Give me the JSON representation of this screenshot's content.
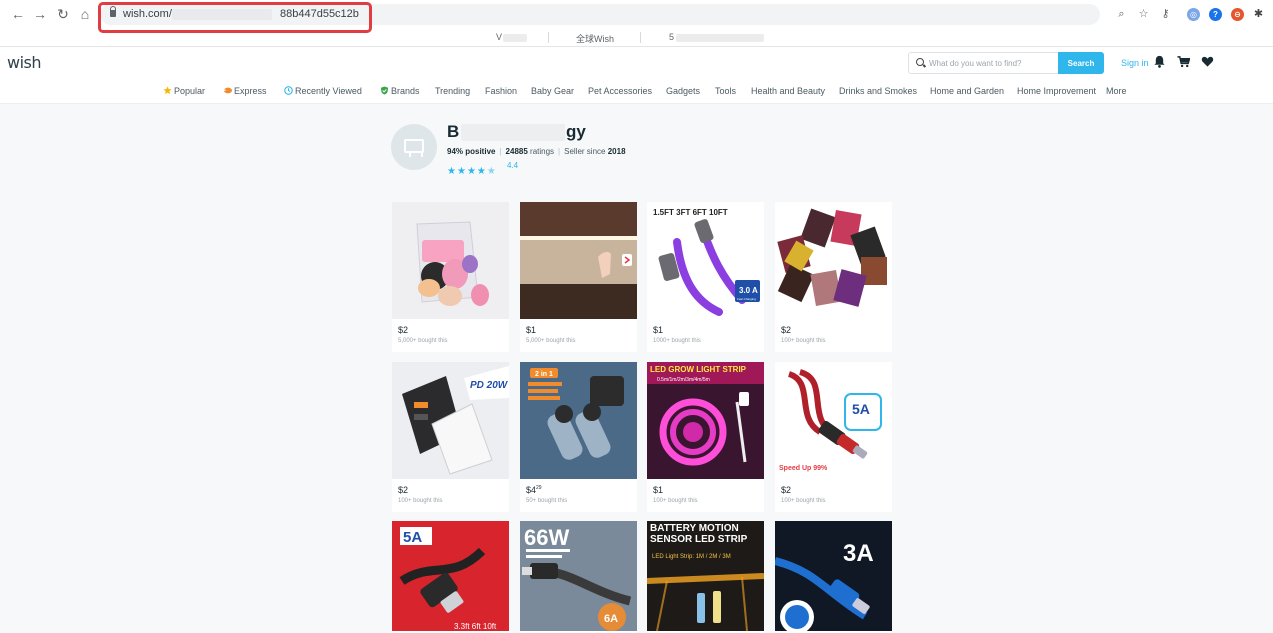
{
  "browser": {
    "url_domain": "wish.com/",
    "url_tail": "88b447d55c12b",
    "bookmarks": [
      {
        "label": "V"
      },
      {
        "label": "全球Wish"
      },
      {
        "label": "5"
      }
    ]
  },
  "header": {
    "logo": "wish",
    "search_placeholder": "What do you want to find?",
    "search_button": "Search",
    "sign_in": "Sign in"
  },
  "categories": [
    {
      "label": "Popular",
      "icon": "star-icon"
    },
    {
      "label": "Express",
      "icon": "express-icon"
    },
    {
      "label": "Recently Viewed",
      "icon": "clock-icon"
    },
    {
      "label": "Brands",
      "icon": "shield-icon"
    },
    {
      "label": "Trending"
    },
    {
      "label": "Fashion"
    },
    {
      "label": "Baby Gear"
    },
    {
      "label": "Pet Accessories"
    },
    {
      "label": "Gadgets"
    },
    {
      "label": "Tools"
    },
    {
      "label": "Health and Beauty"
    },
    {
      "label": "Drinks and Smokes"
    },
    {
      "label": "Home and Garden"
    },
    {
      "label": "Home Improvement"
    },
    {
      "label": "More"
    }
  ],
  "store": {
    "name_start": "B",
    "name_end": "gy",
    "positive": "94% positive",
    "ratings_count": "24885",
    "ratings_label": "ratings",
    "seller_since_label": "Seller since",
    "seller_since_year": "2018",
    "rating": "4.4",
    "stars_filled": 4.5
  },
  "products": [
    {
      "price": "$2",
      "bought": "5,000+ bought this",
      "image": "beauty-sponges"
    },
    {
      "price": "$1",
      "bought": "5,000+ bought this",
      "image": "motion-sensor-cabinet-light"
    },
    {
      "price": "$1",
      "bought": "1000+ bought this",
      "image": "usb-c-cable-purple",
      "overlay_top": "1.5FT 3FT 6FT 10FT",
      "overlay_badge": "3.0 A",
      "overlay_sub": "Fast Charging"
    },
    {
      "price": "$2",
      "bought": "100+ bought this",
      "image": "leather-card-holders"
    },
    {
      "price": "$2",
      "bought": "100+ bought this",
      "image": "usb-wall-charger",
      "overlay_badge": "PD 20W"
    },
    {
      "price": "$4",
      "price_sup": "29",
      "bought": "50+ bought this",
      "image": "wireless-lavalier-mic",
      "overlay_top": "2 in 1"
    },
    {
      "price": "$1",
      "bought": "100+ bought this",
      "image": "led-grow-light-strip",
      "overlay_top": "LED GROW LIGHT STRIP",
      "overlay_sub": "0.5m/1m/2m/3m/4m/5m"
    },
    {
      "price": "$2",
      "bought": "100+ bought this",
      "image": "red-usb-c-cable",
      "overlay_badge": "5A",
      "overlay_sub": "Speed Up 99%"
    },
    {
      "image": "5a-usb-cable-red",
      "overlay_badge": "5A",
      "overlay_sub": "3.3ft 6ft 10ft"
    },
    {
      "image": "66w-braided-cable",
      "overlay_top": "66W",
      "overlay_badge": "6A"
    },
    {
      "image": "battery-motion-led-strip",
      "overlay_top": "BATTERY MOTION SENSOR LED STRIP",
      "overlay_sub": "LED Light Strip: 1M / 2M / 3M"
    },
    {
      "image": "3a-blue-cable",
      "overlay_top": "3A"
    }
  ]
}
